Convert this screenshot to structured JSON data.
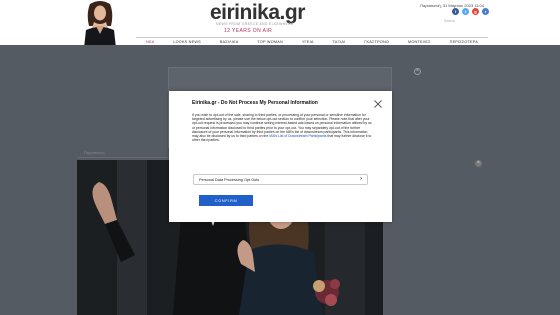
{
  "header": {
    "logo": "eirinika.gr",
    "tagline": "NEWS FROM GREECE AND ELSEWHERE",
    "years": "12 YEARS ON AIR",
    "date": "Παρασκευή, 31 Μαρτίου 2023 11:04",
    "search_placeholder": "Search",
    "socials": [
      {
        "icon": "facebook-icon",
        "glyph": "f",
        "color": "#3b5998"
      },
      {
        "icon": "twitter-icon",
        "glyph": "t",
        "color": "#55acee"
      },
      {
        "icon": "google-plus-icon",
        "glyph": "g",
        "color": "#dd4b39"
      },
      {
        "icon": "rss-icon",
        "glyph": "r",
        "color": "#4b7fc4"
      }
    ]
  },
  "nav": {
    "items": [
      "ΝΕΑ",
      "LOOKS NEWS",
      "ΒΑΣΙΛΙΚΑ",
      "TOP WOMAN",
      "ΥΓΕΙΑ",
      "ΤΑΞΙΔΙ",
      "ΓΚΑΣΤΡΟΝΟ",
      "ΜΟΝΤΕΛΕΣ",
      "ΠΕΡΙΣΣΟΤΕΡΑ"
    ]
  },
  "article": {
    "breadcrumb": "Παρασκευή"
  },
  "modal": {
    "title": "Eirinika.gr - Do Not Process My Personal Information",
    "body_before_link": "If you wish to opt-out of the sale, sharing to third parties, or processing of your personal or sensitive information for targeted advertising by us, please use the below opt-out section to confirm your selection. Please note that after your opt-out request is processed you may continue seeing interest-based ads based on personal information utilized by us or personal information disclosed to third parties prior to your opt-out. You may separately opt-out of the further disclosure of your personal information by third parties on the IAB's list of downstream participants. This information may also be disclosed by us to third parties on the ",
    "link_text": "IAB's List of Downstream Participants",
    "body_after_link": " that may further disclose it to other third parties.",
    "row_label": "Personal Data Processing Opt Outs",
    "confirm_label": "CONFIRM"
  },
  "colors": {
    "accent": "#b03060",
    "button": "#2060c8",
    "overlay": "#555b63"
  }
}
